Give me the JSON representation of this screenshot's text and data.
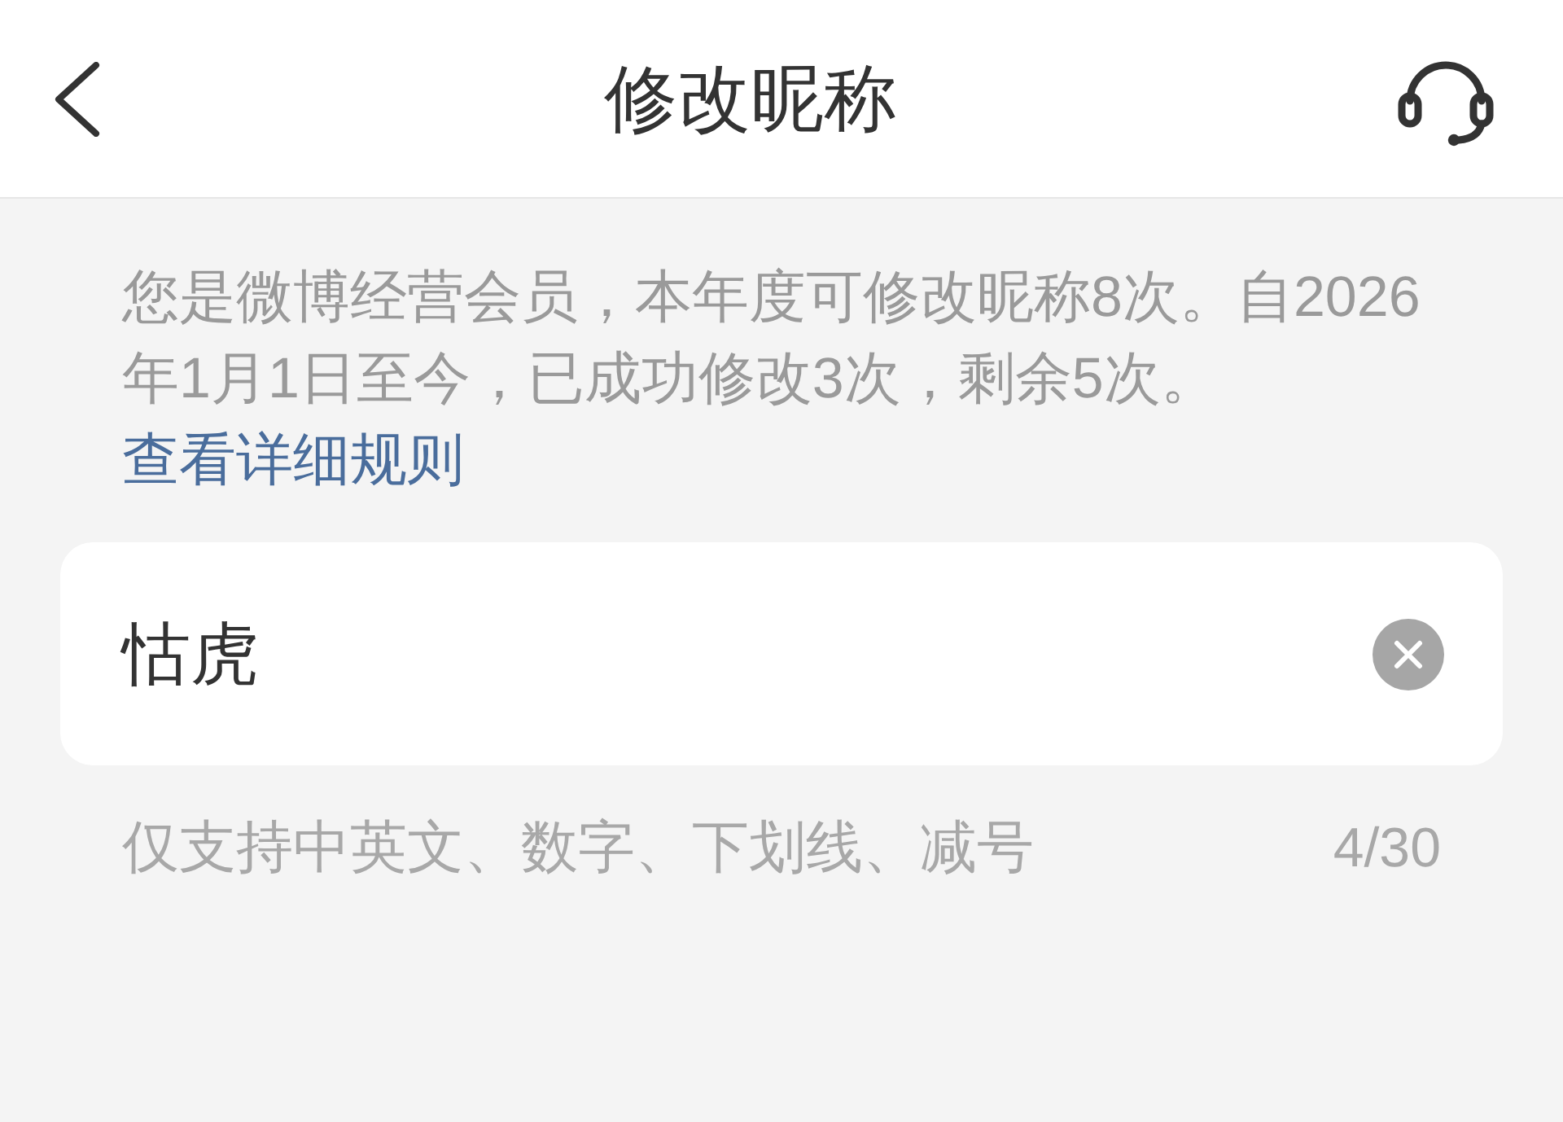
{
  "header": {
    "title": "修改昵称"
  },
  "notice": {
    "text": "您是微博经营会员，本年度可修改昵称8次。自2026年1月1日至今，已成功修改3次，剩余5次。",
    "link": "查看详细规则"
  },
  "nickname_field": {
    "value": "怙虎"
  },
  "hint": {
    "text": "仅支持中英文、数字、下划线、减号",
    "counter": "4/30"
  }
}
